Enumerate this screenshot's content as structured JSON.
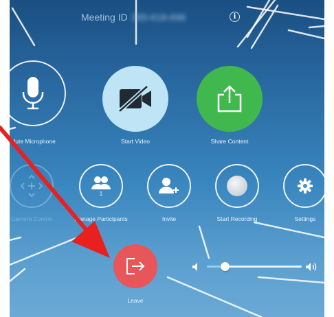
{
  "header": {
    "meeting_id_label": "Meeting ID",
    "meeting_id_value": "285-618-696",
    "info_icon": "info-icon"
  },
  "primary_controls": [
    {
      "label": "Mute Microphone",
      "icon": "microphone-icon"
    },
    {
      "label": "Start Video",
      "icon": "video-off-icon"
    },
    {
      "label": "Share Content",
      "icon": "share-upload-icon"
    }
  ],
  "secondary_controls": [
    {
      "label": "Camera Control",
      "icon": "camera-control-icon",
      "state": "disabled"
    },
    {
      "label": "Manage Participants",
      "icon": "participants-icon",
      "badge": "1"
    },
    {
      "label": "Invite",
      "icon": "add-user-icon"
    },
    {
      "label": "Start Recording",
      "icon": "record-icon"
    },
    {
      "label": "Settings",
      "icon": "gear-icon"
    }
  ],
  "leave": {
    "label": "Leave",
    "icon": "leave-icon"
  },
  "volume": {
    "level": 0.19,
    "min_icon": "volume-low-icon",
    "max_icon": "volume-high-icon"
  },
  "colors": {
    "video_button": "#bfe4f5",
    "share_button": "#40b84e",
    "leave_button": "#e8565a",
    "arrow": "#e82020"
  }
}
